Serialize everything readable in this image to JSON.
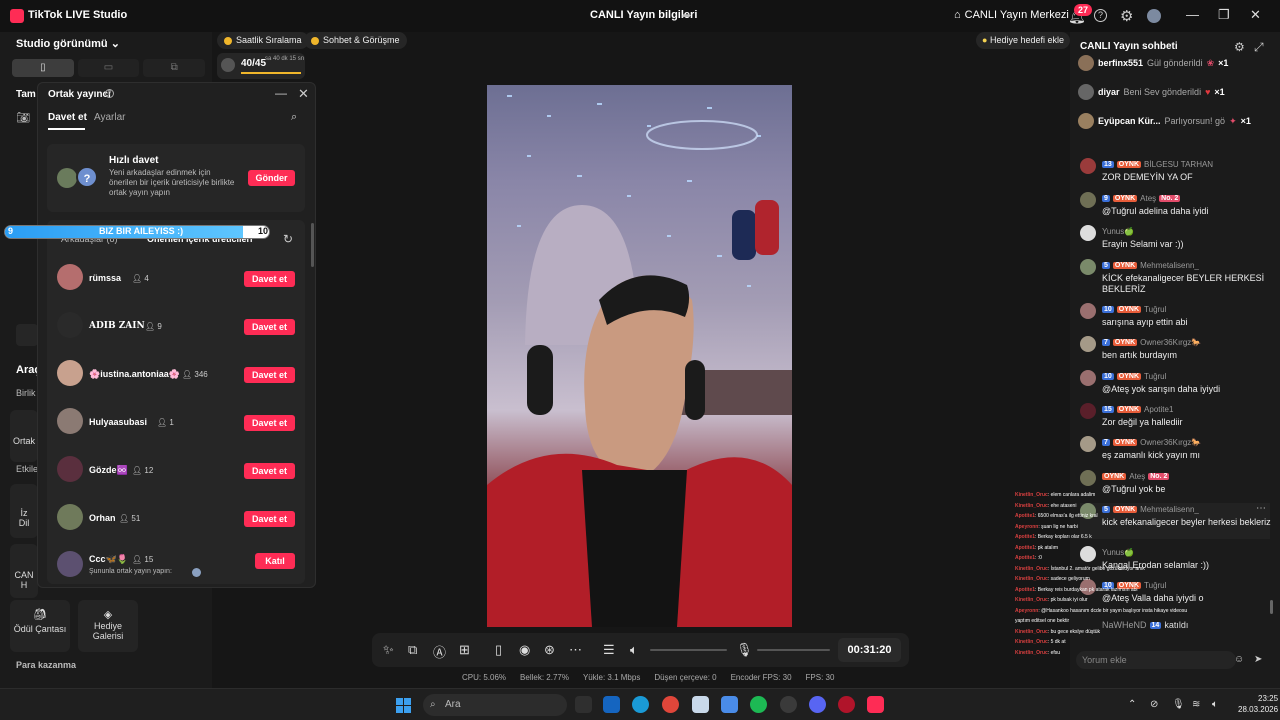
{
  "titlebar": {
    "app_title": "TikTok LIVE Studio",
    "center_title": "CANLI Yayın bilgileri",
    "center_link": "CANLI Yayın Merkezi",
    "notification_count": "27"
  },
  "left": {
    "studio_view": "Studio görünümü",
    "tam": "Tam",
    "araclar": "Araç",
    "birlik": "Birlik",
    "ortak": "Ortak",
    "etkilesim": "Etkile",
    "izle": "İz",
    "dil": "Dil",
    "canli": "CAN",
    "h": "H",
    "tools": [
      "Ödül Çantası",
      "Hediye Galerisi"
    ],
    "para": "Para kazanma"
  },
  "chips": {
    "hourly": "Saatlik Sıralama",
    "chat_match": "Sohbet & Görüşme",
    "progress": "40/45",
    "progress_sub": "sa 40 dk 15 sn",
    "gift_goal": "Hediye hedefi ekle"
  },
  "cohost": {
    "title": "Ortak yayıncı",
    "tabs": [
      "Davet et",
      "Ayarlar"
    ],
    "quick": {
      "title": "Hızlı davet",
      "desc": "Yeni arkadaşlar edinmek için önerilen bir içerik üreticisiyle birlikte ortak yayın yapın",
      "button": "Gönder"
    },
    "list_header_left": "Arkadaşlar (8)",
    "list_header_right": "Önerilen içerik üreticileri",
    "items": [
      {
        "name": "rümssa",
        "count": "4",
        "button": "Davet et"
      },
      {
        "name": "ADIB ZAIN",
        "count": "9",
        "button": "Davet et"
      },
      {
        "name": "🌸iustina.antoniaa🌸",
        "count": "346",
        "button": "Davet et"
      },
      {
        "name": "Hulyaasubasi",
        "count": "1",
        "button": "Davet et"
      },
      {
        "name": "Gözde♾️",
        "count": "12",
        "button": "Davet et"
      },
      {
        "name": "Orhan",
        "count": "51",
        "button": "Davet et"
      },
      {
        "name": "Ccc🦋🌷",
        "count": "15",
        "button": "Katıl",
        "sub": "Şununla ortak yayın yapın:"
      }
    ]
  },
  "team_bar": {
    "left": "9",
    "title": "BIZ BIR AILEYISS :)",
    "right": "10",
    "fill": 0.9
  },
  "controls": {
    "timer": "00:31:20"
  },
  "stats": [
    "CPU: 5.06%",
    "Bellek: 2.77%",
    "Yükle: 3.1 Mbps",
    "Düşen çerçeve: 0",
    "Encoder FPS: 30",
    "FPS: 30"
  ],
  "chat": {
    "title": "CANLI Yayın sohbeti",
    "gifts": [
      {
        "user": "berfinx551",
        "action": "Gül gönderildi",
        "count": "×1"
      },
      {
        "user": "diyar",
        "action": "Beni Sev gönderildi",
        "count": "×1"
      },
      {
        "user": "Eyüpcan Kür...",
        "action": "Parlıyorsun! gö",
        "count": "×1"
      }
    ],
    "messages": [
      {
        "level": "13",
        "user": "BİLGESU TARHAN",
        "text": "ZOR DEMEYİN YA OF",
        "no2": ""
      },
      {
        "level": "9",
        "user": "Ateş",
        "text": "@Tuğrul adelina daha iyidi",
        "no2": "No. 2"
      },
      {
        "level": "",
        "user": "Yunus🍏",
        "text": "Erayin Selami var :))",
        "no2": ""
      },
      {
        "level": "5",
        "user": "Mehmetalisenn_",
        "text": "KİCK efekanaligecer BEYLER HERKESİ BEKLERİZ",
        "no2": ""
      },
      {
        "level": "10",
        "user": "Tuğrul",
        "text": "sarışına ayıp ettin abi",
        "no2": ""
      },
      {
        "level": "7",
        "user": "Owner36Kırgz🐎",
        "text": "ben artık burdayım",
        "no2": ""
      },
      {
        "level": "10",
        "user": "Tuğrul",
        "text": "@Ateş yok sarışın daha iyiydi",
        "no2": ""
      },
      {
        "level": "15",
        "user": "Apotite1",
        "text": "Zor değil ya hallediir",
        "no2": ""
      },
      {
        "level": "7",
        "user": "Owner36Kırgz🐎",
        "text": "eş zamanlı kick yayın mı",
        "no2": ""
      },
      {
        "level": "",
        "user": "Ateş",
        "text": "@Tuğrul yok be",
        "no2": "No. 2"
      },
      {
        "level": "5",
        "user": "Mehmetalisenn_",
        "text": "kick efekanaligecer beyler herkesi bekleriz",
        "no2": ""
      },
      {
        "level": "",
        "user": "Yunus🍏",
        "text": "Kangal Erodan selamlar :))",
        "no2": ""
      },
      {
        "level": "10",
        "user": "Tuğrul",
        "text": "@Ateş Valla daha iyiydi o",
        "no2": ""
      },
      {
        "level": "14",
        "user": "NaWHeND",
        "text": "",
        "joined": "katıldı",
        "no2": ""
      }
    ],
    "input_placeholder": "Yorum ekle",
    "oynk": "OYNK"
  },
  "feed": [
    {
      "u": "Kinetlin_Oruc",
      "t": ": elem canlara adalim"
    },
    {
      "u": "Kinetlin_Oruc",
      "t": ": ehe ataseni"
    },
    {
      "u": "Apotite1",
      "t": ": 6500 elmas'a ilg ettiniz kral"
    },
    {
      "u": "Apeyronn",
      "t": ": şuan lig ne harbi"
    },
    {
      "u": "Apotite1",
      "t": ": Berkay kopları olar 6.5 k"
    },
    {
      "u": "Apotite1",
      "t": ": pk atalım"
    },
    {
      "u": "Apotite1",
      "t": ": :0"
    },
    {
      "u": "Kinetlin_Oruc",
      "t": ": İstanbul 2. amatör gelibe gözükmüyor amk"
    },
    {
      "u": "Kinetlin_Oruc",
      "t": ": sadece geliyorum"
    },
    {
      "u": "Apotite1",
      "t": ": Berkay reis burdaykan pk atarak lazımsın abi"
    },
    {
      "u": "Kinetlin_Oruc",
      "t": ": pk bulsak iyi olur"
    },
    {
      "u": "Apeyronn",
      "t": ": @Hasankoo hasanım dcde bir yayın başlıyor insta hikaye videosu"
    },
    {
      "u": "",
      "t": "yaptım editsel one bektir"
    },
    {
      "u": "Kinetlin_Oruc",
      "t": ": bu gece ekslye düştük"
    },
    {
      "u": "Kinetlin_Oruc",
      "t": ": 5 dk at"
    },
    {
      "u": "Kinetlin_Oruc",
      "t": ": efsu"
    }
  ],
  "taskbar": {
    "search": "Ara",
    "time": "23:25",
    "date": "28.03.2026"
  },
  "colors": {
    "accent": "#fe2c55",
    "level_blue": "#3a6fd8",
    "oynk": "#e85d3a",
    "bg": "#161616",
    "panel": "#1b1b1b"
  }
}
